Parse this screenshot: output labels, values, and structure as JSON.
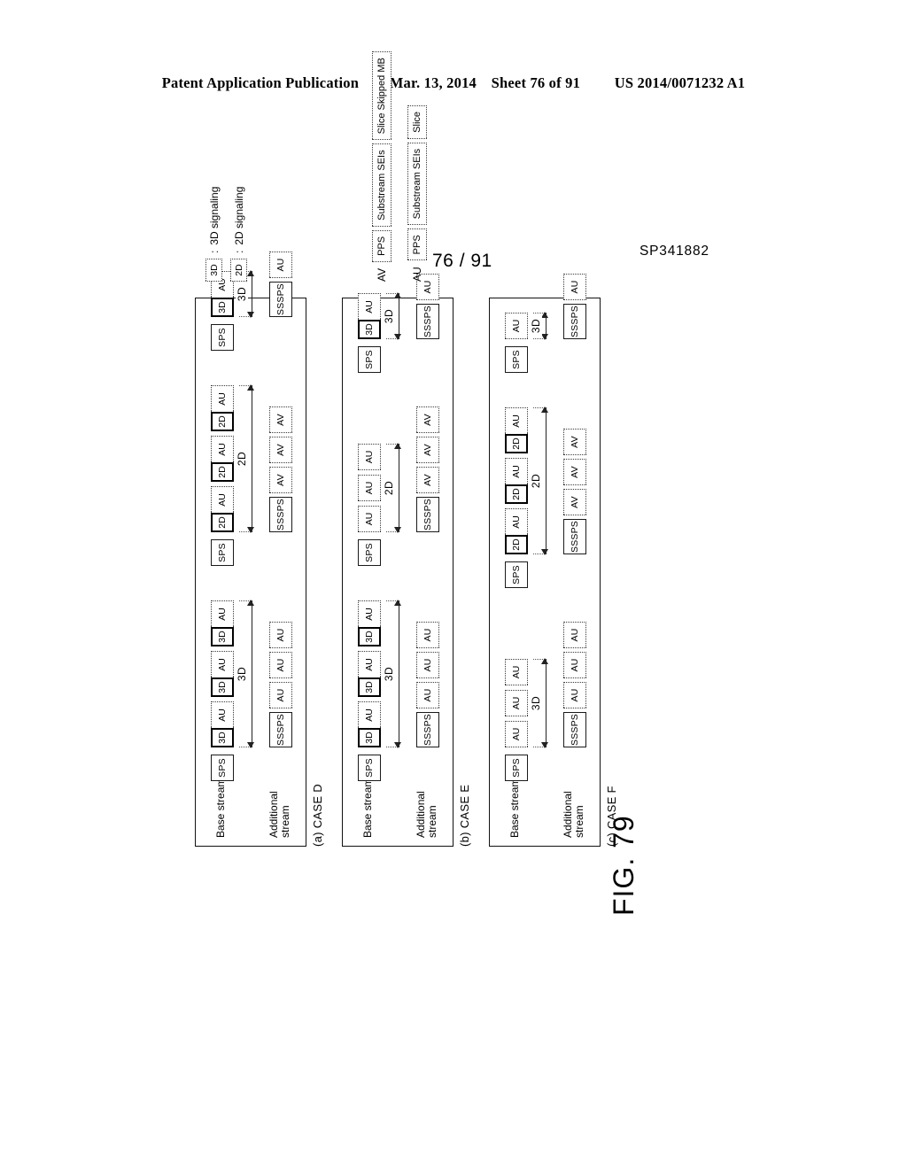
{
  "header": {
    "publication": "Patent Application Publication",
    "date": "Mar. 13, 2014",
    "sheet": "Sheet 76 of 91",
    "patent_number": "US 2014/0071232 A1"
  },
  "sheet_fraction": "76 / 91",
  "doc_code": "SP341882",
  "figure": {
    "label": "FIG. 79"
  },
  "labels": {
    "base_stream": "Base stream",
    "additional_stream": "Additional\nstream",
    "au": "AU",
    "av": "AV",
    "sps": "SPS",
    "sssps": "SSSPS",
    "marker_3d": "3D",
    "marker_2d": "2D",
    "span_3d": "3D",
    "span_2d": "2D"
  },
  "panels": [
    {
      "id": "a",
      "case_label": "(a) CASE D",
      "base_stream_label": "Base stream",
      "additional_stream_label": "Additional stream",
      "segments": [
        {
          "kind": "3D",
          "span_label": "3D",
          "base": {
            "sps": "SPS",
            "aus": [
              {
                "marker": "3D",
                "body": "AU"
              },
              {
                "marker": "3D",
                "body": "AU"
              },
              {
                "marker": "3D",
                "body": "AU"
              }
            ]
          },
          "additional": [
            "SSSPS",
            "AU",
            "AU",
            "AU"
          ]
        },
        {
          "kind": "2D",
          "span_label": "2D",
          "base": {
            "sps": "SPS",
            "aus": [
              {
                "marker": "2D",
                "body": "AU"
              },
              {
                "marker": "2D",
                "body": "AU"
              },
              {
                "marker": "2D",
                "body": "AU"
              }
            ]
          },
          "additional": [
            "SSSPS",
            "AV",
            "AV",
            "AV"
          ]
        },
        {
          "kind": "3D",
          "span_label": "3D",
          "base": {
            "sps": "SPS",
            "aus": [
              {
                "marker": "3D",
                "body": "AU"
              }
            ]
          },
          "additional": [
            "SSSPS",
            "AU"
          ]
        }
      ]
    },
    {
      "id": "b",
      "case_label": "(b) CASE E",
      "base_stream_label": "Base stream",
      "additional_stream_label": "Additional stream",
      "segments": [
        {
          "kind": "3D",
          "span_label": "3D",
          "base": {
            "sps": "SPS",
            "aus": [
              {
                "marker": "3D",
                "body": "AU"
              },
              {
                "marker": "3D",
                "body": "AU"
              },
              {
                "marker": "3D",
                "body": "AU"
              }
            ]
          },
          "additional": [
            "SSSPS",
            "AU",
            "AU",
            "AU"
          ]
        },
        {
          "kind": "2D",
          "span_label": "2D",
          "base": {
            "sps": "SPS",
            "aus": [
              {
                "marker": null,
                "body": "AU"
              },
              {
                "marker": null,
                "body": "AU"
              },
              {
                "marker": null,
                "body": "AU"
              }
            ]
          },
          "additional": [
            "SSSPS",
            "AV",
            "AV",
            "AV"
          ]
        },
        {
          "kind": "3D",
          "span_label": "3D",
          "base": {
            "sps": "SPS",
            "aus": [
              {
                "marker": "3D",
                "body": "AU"
              }
            ]
          },
          "additional": [
            "SSSPS",
            "AU"
          ]
        }
      ]
    },
    {
      "id": "c",
      "case_label": "(c) CASE F",
      "base_stream_label": "Base stream",
      "additional_stream_label": "Additional stream",
      "segments": [
        {
          "kind": "3D",
          "span_label": "3D",
          "base": {
            "sps": "SPS",
            "aus": [
              {
                "marker": null,
                "body": "AU"
              },
              {
                "marker": null,
                "body": "AU"
              },
              {
                "marker": null,
                "body": "AU"
              }
            ]
          },
          "additional": [
            "SSSPS",
            "AU",
            "AU",
            "AU"
          ]
        },
        {
          "kind": "2D",
          "span_label": "2D",
          "base": {
            "sps": "SPS",
            "aus": [
              {
                "marker": "2D",
                "body": "AU"
              },
              {
                "marker": "2D",
                "body": "AU"
              },
              {
                "marker": "2D",
                "body": "AU"
              }
            ]
          },
          "additional": [
            "SSSPS",
            "AV",
            "AV",
            "AV"
          ]
        },
        {
          "kind": "3D",
          "span_label": "3D",
          "base": {
            "sps": "SPS",
            "aus": [
              {
                "marker": null,
                "body": "AU"
              }
            ]
          },
          "additional": [
            "SSSPS",
            "AU"
          ]
        }
      ]
    }
  ],
  "legend": {
    "signaling": [
      {
        "box": "3D",
        "separator": ":",
        "text": "3D signaling"
      },
      {
        "box": "2D",
        "separator": ":",
        "text": "2D signaling"
      }
    ],
    "structures": [
      {
        "name": "AV",
        "parts": [
          "PPS",
          "Substream SEIs",
          "Slice Skipped MB"
        ]
      },
      {
        "name": "AU",
        "parts": [
          "PPS",
          "Substream SEIs",
          "Slice"
        ]
      }
    ]
  }
}
